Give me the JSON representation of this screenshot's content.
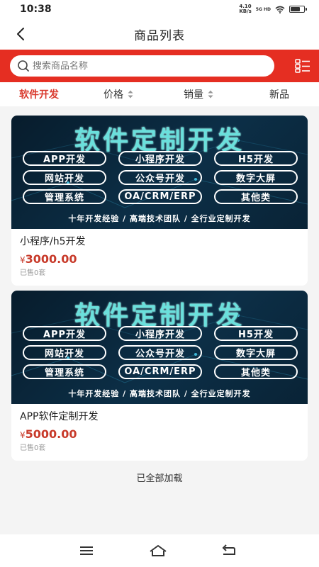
{
  "status_bar": {
    "time": "10:38",
    "speed_value": "4.10",
    "speed_unit": "KB/s",
    "network": "5G HD",
    "battery_level": 0.75,
    "icons": [
      "wifi-icon",
      "battery-icon"
    ]
  },
  "nav": {
    "title": "商品列表",
    "back_icon": "chevron-left-icon"
  },
  "search": {
    "placeholder": "搜索商品名称",
    "value": "",
    "layout_toggle_icon": "list-view-icon"
  },
  "colors": {
    "brand_red": "#e52e22",
    "active_tab": "#d9382c",
    "price": "#c83a2a",
    "banner_title": "#6ae0dc"
  },
  "filters": {
    "tabs": [
      {
        "label": "软件开发",
        "active": true,
        "sortable": false
      },
      {
        "label": "价格",
        "active": false,
        "sortable": true
      },
      {
        "label": "销量",
        "active": false,
        "sortable": true
      },
      {
        "label": "新品",
        "active": false,
        "sortable": false
      }
    ]
  },
  "banner": {
    "title": "软件定制开发",
    "services": [
      "APP开发",
      "小程序开发",
      "H5开发",
      "网站开发",
      "公众号开发",
      "数字大屏",
      "管理系统",
      "OA/CRM/ERP",
      "其他类"
    ],
    "tagline": "十年开发经验 / 高端技术团队 / 全行业定制开发"
  },
  "products": [
    {
      "name": "小程序/h5开发",
      "currency": "¥",
      "price": "3000.00",
      "sold": "已售0套"
    },
    {
      "name": "APP软件定制开发",
      "currency": "¥",
      "price": "5000.00",
      "sold": "已售0套"
    }
  ],
  "list_end_text": "已全部加载",
  "system_nav": {
    "icons": [
      "menu-icon",
      "home-icon",
      "back-icon"
    ]
  }
}
